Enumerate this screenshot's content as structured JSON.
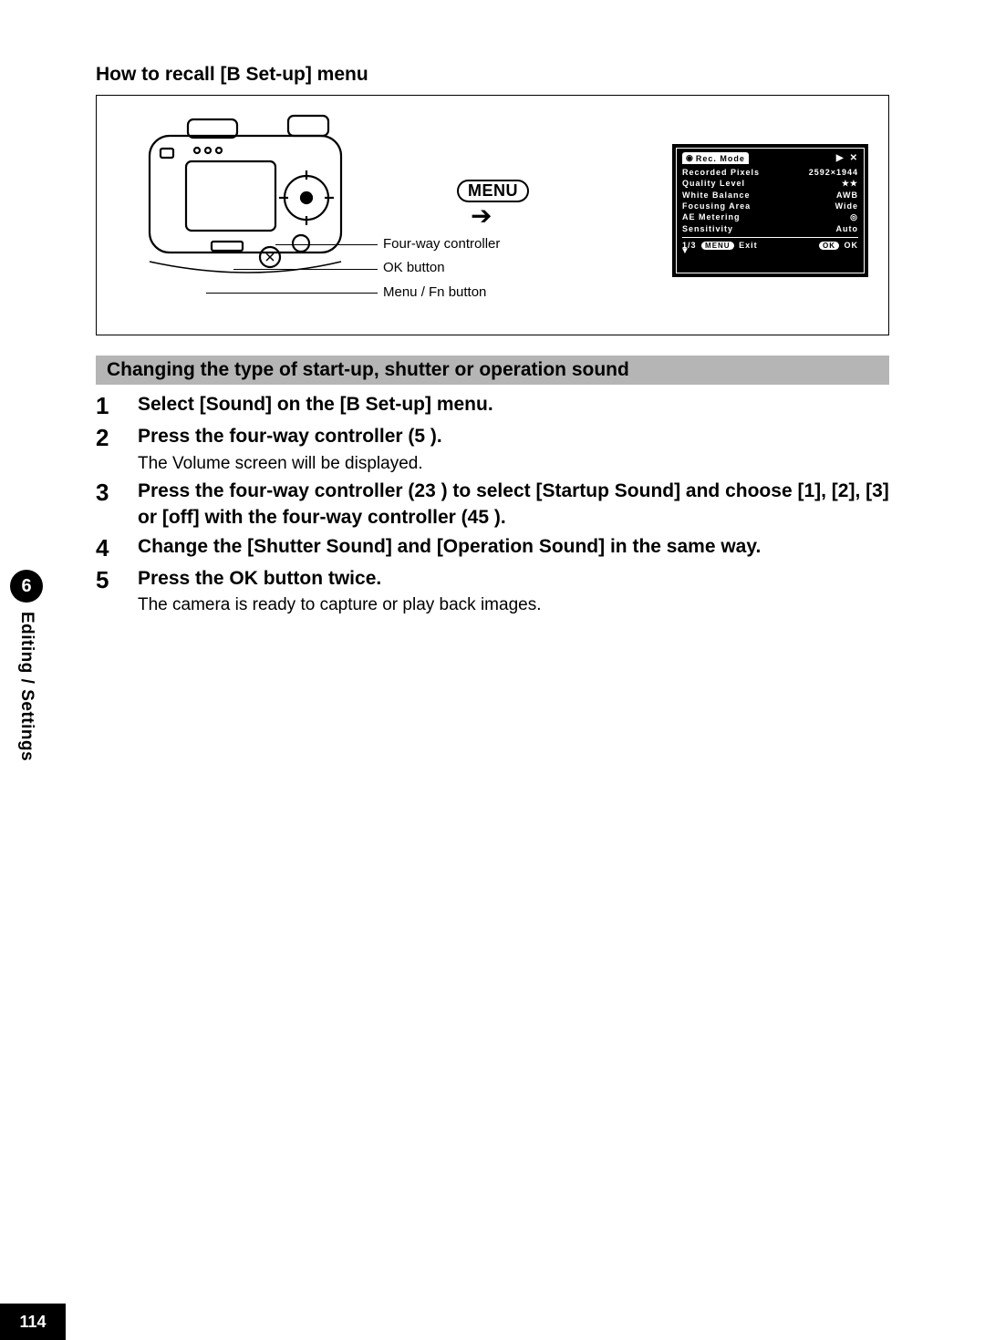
{
  "heading": "How to recall [B Set-up] menu",
  "diagram": {
    "menu_label": "MENU",
    "labels": {
      "fourway": "Four-way controller",
      "ok": "OK button",
      "menufn": "Menu / Fn button"
    }
  },
  "lcd": {
    "title": "Rec. Mode",
    "tab_icon": "▶",
    "tool_icon": "✕",
    "rows": [
      {
        "l": "Recorded Pixels",
        "r": "2592×1944"
      },
      {
        "l": "Quality Level",
        "r": "★★"
      },
      {
        "l": "White Balance",
        "r": "AWB"
      },
      {
        "l": "Focusing Area",
        "r": "Wide"
      },
      {
        "l": "AE Metering",
        "r": "◎"
      },
      {
        "l": "Sensitivity",
        "r": "Auto"
      }
    ],
    "page": "1/3",
    "exit_pill": "MENU",
    "exit_text": "Exit",
    "ok_pill": "OK",
    "ok_text": "OK"
  },
  "section_title": "Changing the type of start-up, shutter or operation sound",
  "steps": [
    {
      "n": "1",
      "title": "Select [Sound] on the [B Set-up] menu.",
      "desc": ""
    },
    {
      "n": "2",
      "title": "Press the four-way controller (5 ).",
      "desc": "The Volume screen will be displayed."
    },
    {
      "n": "3",
      "title": "Press the four-way controller (23 ) to select [Startup Sound] and choose [1], [2], [3] or [off] with the four-way controller (45 ).",
      "desc": ""
    },
    {
      "n": "4",
      "title": "Change the [Shutter Sound] and [Operation Sound] in the same way.",
      "desc": ""
    },
    {
      "n": "5",
      "title": "Press the OK button twice.",
      "desc": "The camera is ready to capture or play back images."
    }
  ],
  "sidebar": {
    "num": "6",
    "label": "Editing / Settings"
  },
  "page_number": "114"
}
